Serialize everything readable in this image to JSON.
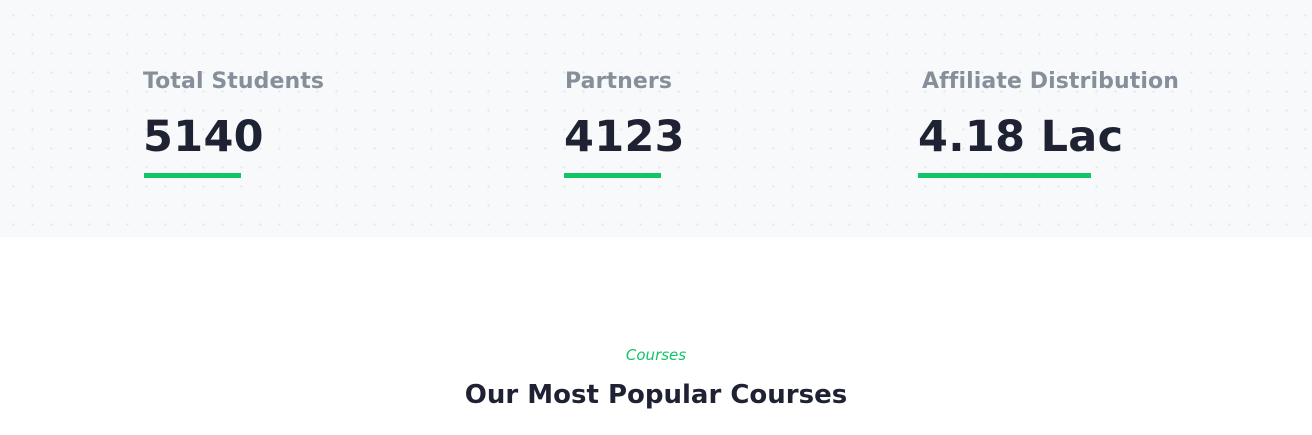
{
  "stats": [
    {
      "label": "Total Students",
      "value": "5140"
    },
    {
      "label": "Partners",
      "value": "4123"
    },
    {
      "label": "Affiliate Distribution",
      "value": "4.18 Lac"
    }
  ],
  "courses_section": {
    "kicker": "Courses",
    "title": "Our Most Popular Courses"
  },
  "colors": {
    "accent": "#12c468",
    "heading": "#1e2232",
    "label": "#878f9b",
    "band_background": "#f8f9fb"
  }
}
